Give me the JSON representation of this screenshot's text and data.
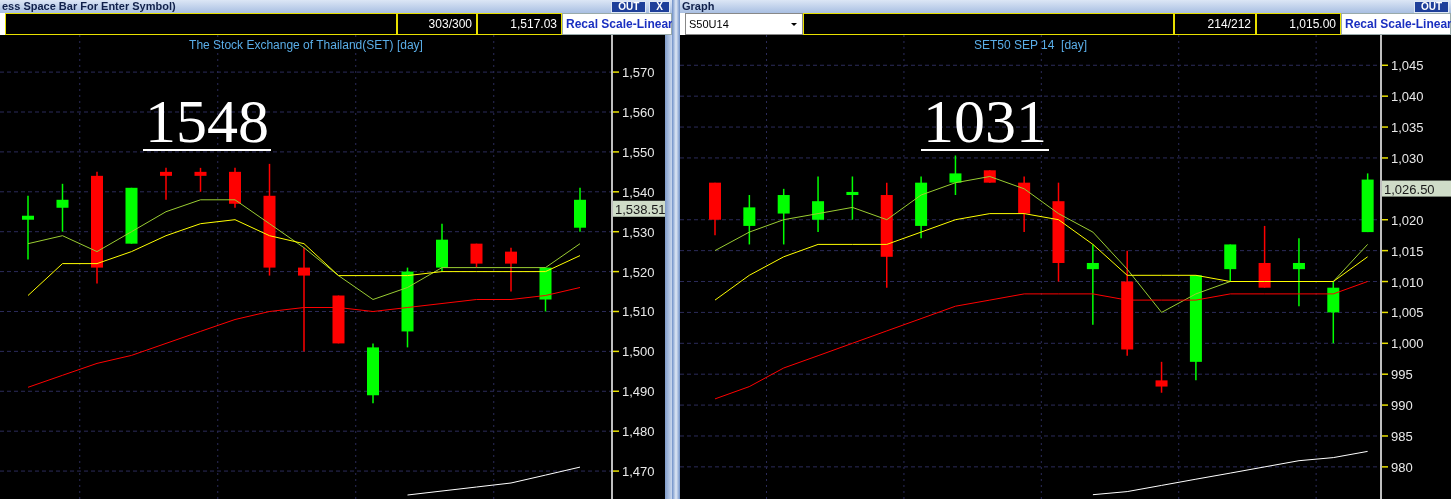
{
  "panels": [
    {
      "title_bar": {
        "title": "ess Space Bar For Enter Symbol)",
        "buttons": [
          "OUT",
          "X"
        ]
      },
      "toolbar": {
        "counter": "303/300",
        "price": "1,517.03",
        "scale_button": "Recal Scale-Linear"
      },
      "chart": {
        "price_tag": "1,538.51",
        "chart_data": {
          "type": "candlestick",
          "title": "The Stock Exchange of Thailand(SET) [day]",
          "grid": true,
          "ylim": [
            1463,
            1579.3
          ],
          "yticks": [
            {
              "value": 1570,
              "label": "1,570"
            },
            {
              "value": 1560,
              "label": "1,560"
            },
            {
              "value": 1550,
              "label": "1,550"
            },
            {
              "value": 1540,
              "label": "1,540"
            },
            {
              "value": 1530,
              "label": "1,530"
            },
            {
              "value": 1520,
              "label": "1,520"
            },
            {
              "value": 1510,
              "label": "1,510"
            },
            {
              "value": 1500,
              "label": "1,500"
            },
            {
              "value": 1490,
              "label": "1,490"
            },
            {
              "value": 1480,
              "label": "1,480"
            },
            {
              "value": 1470,
              "label": "1,470"
            }
          ],
          "ohlc": [
            [
              1533,
              1539,
              1523,
              1534
            ],
            [
              1536,
              1542,
              1530,
              1538
            ],
            [
              1544,
              1545,
              1517,
              1521
            ],
            [
              1527,
              1541,
              1527,
              1541
            ],
            [
              1545,
              1546,
              1538,
              1544
            ],
            [
              1545,
              1546,
              1540,
              1544
            ],
            [
              1545,
              1546,
              1536,
              1537
            ],
            [
              1539,
              1547,
              1519,
              1521
            ],
            [
              1521,
              1526,
              1500,
              1519
            ],
            [
              1514,
              1514,
              1502,
              1502
            ],
            [
              1489,
              1502,
              1487,
              1501
            ],
            [
              1505,
              1521,
              1501,
              1520
            ],
            [
              1521,
              1532,
              1520,
              1528
            ],
            [
              1527,
              1527,
              1521,
              1522
            ],
            [
              1525,
              1526,
              1515,
              1522
            ],
            [
              1513,
              1521,
              1510,
              1521
            ],
            [
              1531,
              1541,
              1530,
              1538
            ]
          ],
          "series": [
            {
              "type": "line",
              "color": "#9acd32",
              "values": [
                1527,
                1529,
                1525,
                1530,
                1535,
                1538,
                1538,
                1532,
                1526,
                1519,
                1513,
                1516,
                1521,
                1521,
                1521,
                1521,
                1527
              ]
            },
            {
              "type": "line",
              "color": "#ffff00",
              "values": [
                1514,
                1522,
                1522,
                1525,
                1529,
                1532,
                1533,
                1529,
                1527,
                1519,
                1519,
                1519,
                1520,
                1520,
                1520,
                1520,
                1524
              ]
            },
            {
              "type": "line",
              "color": "#ff0000",
              "values": [
                1491,
                1494,
                1497,
                1499,
                1502,
                1505,
                1508,
                1510,
                1511,
                1511,
                1510,
                1511,
                1512,
                1513,
                1513,
                1514,
                1516
              ]
            },
            {
              "type": "line",
              "color": "#ffffff",
              "values": [
                null,
                null,
                null,
                null,
                null,
                null,
                null,
                null,
                null,
                null,
                null,
                1464,
                1465,
                1466,
                1467,
                1469,
                1471
              ]
            }
          ],
          "annotations": [
            "1548"
          ]
        }
      }
    },
    {
      "title_bar": {
        "title": "Graph",
        "buttons": [
          "OUT"
        ]
      },
      "toolbar": {
        "symbol": "S50U14",
        "counter": "214/212",
        "price": "1,015.00",
        "scale_button": "Recal Scale-Linear"
      },
      "chart": {
        "price_tag": "1,026.50",
        "chart_data": {
          "type": "candlestick",
          "title": "SET50 SEP 14  [day]",
          "grid": true,
          "ylim": [
            974.8,
            1049.9
          ],
          "yticks": [
            {
              "value": 1045,
              "label": "1,045"
            },
            {
              "value": 1040,
              "label": "1,040"
            },
            {
              "value": 1035,
              "label": "1,035"
            },
            {
              "value": 1030,
              "label": "1,030"
            },
            {
              "value": 1020,
              "label": "1,020"
            },
            {
              "value": 1015,
              "label": "1,015"
            },
            {
              "value": 1010,
              "label": "1,010"
            },
            {
              "value": 1005,
              "label": "1,005"
            },
            {
              "value": 1000,
              "label": "1,000"
            },
            {
              "value": 995,
              "label": "995"
            },
            {
              "value": 990,
              "label": "990"
            },
            {
              "value": 985,
              "label": "985"
            },
            {
              "value": 980,
              "label": "980"
            }
          ],
          "ohlc": [
            [
              1026,
              1026,
              1017.5,
              1020
            ],
            [
              1019,
              1024,
              1016,
              1022
            ],
            [
              1021,
              1025,
              1016,
              1024
            ],
            [
              1020,
              1027,
              1018,
              1023
            ],
            [
              1024,
              1027,
              1020,
              1024.5
            ],
            [
              1024,
              1026,
              1009,
              1014
            ],
            [
              1019,
              1027,
              1017,
              1026
            ],
            [
              1026,
              1030.4,
              1024,
              1027.5
            ],
            [
              1028,
              1028,
              1026,
              1026
            ],
            [
              1026,
              1027,
              1018,
              1021
            ],
            [
              1023,
              1026,
              1010,
              1013
            ],
            [
              1012,
              1016,
              1003,
              1013
            ],
            [
              1010,
              1015,
              998,
              999
            ],
            [
              994,
              997,
              992,
              993
            ],
            [
              997,
              1011,
              994,
              1011
            ],
            [
              1012,
              1016,
              1010,
              1016
            ],
            [
              1013,
              1019,
              1009,
              1009
            ],
            [
              1012,
              1017,
              1006,
              1013
            ],
            [
              1005,
              1010,
              1000,
              1009
            ],
            [
              1018,
              1027.5,
              1018,
              1026.5
            ]
          ],
          "series": [
            {
              "type": "line",
              "color": "#9acd32",
              "values": [
                1015,
                1018,
                1020,
                1021,
                1022,
                1020,
                1024,
                1026,
                1027,
                1025,
                1021,
                1018,
                1012,
                1005,
                1008,
                1010,
                1010,
                1010,
                1010,
                1016
              ]
            },
            {
              "type": "line",
              "color": "#ffff00",
              "values": [
                1007,
                1011,
                1014,
                1016,
                1016,
                1016,
                1018,
                1020,
                1021,
                1021,
                1020,
                1016,
                1011,
                1011,
                1011,
                1010,
                1010,
                1010,
                1010,
                1014
              ]
            },
            {
              "type": "line",
              "color": "#ff0000",
              "values": [
                991,
                993,
                996,
                998,
                1000,
                1002,
                1004,
                1006,
                1007,
                1008,
                1008,
                1008,
                1007,
                1007,
                1007,
                1008,
                1008,
                1008,
                1008,
                1010
              ]
            },
            {
              "type": "line",
              "color": "#ffffff",
              "values": [
                null,
                null,
                null,
                null,
                null,
                null,
                null,
                null,
                null,
                null,
                null,
                975.5,
                976,
                977,
                978,
                979,
                980,
                981,
                981.5,
                982.5
              ]
            }
          ],
          "annotations": [
            "1031"
          ]
        }
      }
    }
  ]
}
